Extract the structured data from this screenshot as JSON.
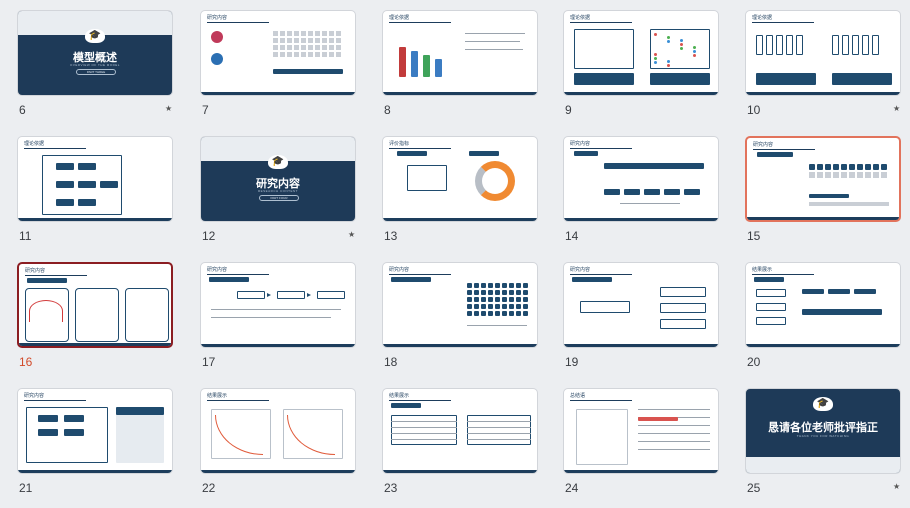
{
  "slides": [
    {
      "number": "6",
      "title": "模型概述",
      "subtitle": "OVERVIEW OF THE MODEL",
      "pill": "PART THREE",
      "type": "title",
      "star": true
    },
    {
      "number": "7",
      "header": "研究内容",
      "type": "content"
    },
    {
      "number": "8",
      "header": "理论依据",
      "type": "content"
    },
    {
      "number": "9",
      "header": "理论依据",
      "type": "content"
    },
    {
      "number": "10",
      "header": "理论依据",
      "type": "content",
      "star": true
    },
    {
      "number": "11",
      "header": "理论依据",
      "type": "content"
    },
    {
      "number": "12",
      "title": "研究内容",
      "subtitle": "RESEARCH CONTENT",
      "pill": "PART FOUR",
      "type": "title",
      "star": true
    },
    {
      "number": "13",
      "header": "评价指标",
      "type": "content"
    },
    {
      "number": "14",
      "header": "研究内容",
      "type": "content"
    },
    {
      "number": "15",
      "header": "研究内容",
      "type": "content",
      "selected": "hover"
    },
    {
      "number": "16",
      "header": "研究内容",
      "type": "content",
      "selected": "active"
    },
    {
      "number": "17",
      "header": "研究内容",
      "type": "content"
    },
    {
      "number": "18",
      "header": "研究内容",
      "type": "content"
    },
    {
      "number": "19",
      "header": "研究内容",
      "type": "content"
    },
    {
      "number": "20",
      "header": "结果展示",
      "type": "content"
    },
    {
      "number": "21",
      "header": "研究内容",
      "type": "content"
    },
    {
      "number": "22",
      "header": "结果展示",
      "type": "content"
    },
    {
      "number": "23",
      "header": "结果展示",
      "type": "content"
    },
    {
      "number": "24",
      "header": "总结语",
      "type": "content"
    },
    {
      "number": "25",
      "title": "恳请各位老师批评指正",
      "subtitle": "THANK YOU FOR WATCHING",
      "type": "title-end",
      "star": true
    }
  ],
  "star_glyph": "★",
  "colors": {
    "navy": "#1e3a58",
    "active_border": "#8b1d22",
    "hover_border": "#e2735c",
    "active_number": "#d24b2b"
  }
}
